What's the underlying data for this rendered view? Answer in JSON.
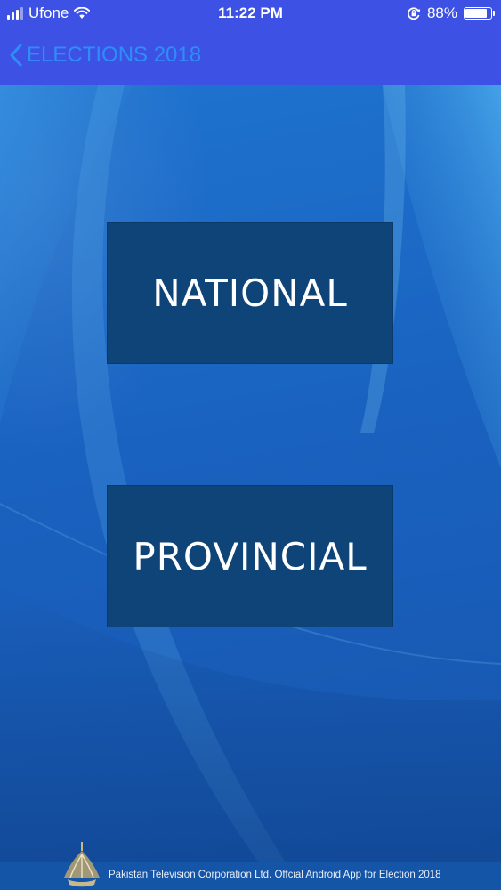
{
  "status_bar": {
    "carrier": "Ufone",
    "time": "11:22 PM",
    "battery_percent": "88%",
    "battery_level": 0.88,
    "icons": [
      "signal-icon",
      "wifi-icon",
      "orientation-lock-icon",
      "battery-icon"
    ]
  },
  "nav": {
    "back_label": "ELECTIONS 2018",
    "back_icon": "chevron-left-icon"
  },
  "buttons": {
    "national": "NATIONAL",
    "provincial": "PROVINCIAL"
  },
  "footer": {
    "text": "Pakistan Television Corporation Ltd.  Offcial Android App for Election 2018",
    "logo_icon": "ptv-logo-icon"
  },
  "colors": {
    "nav_background": "#3d52e4",
    "back_text": "#2e8ef7",
    "button_background": "#0e4477",
    "content_background": "#1a62c0"
  }
}
